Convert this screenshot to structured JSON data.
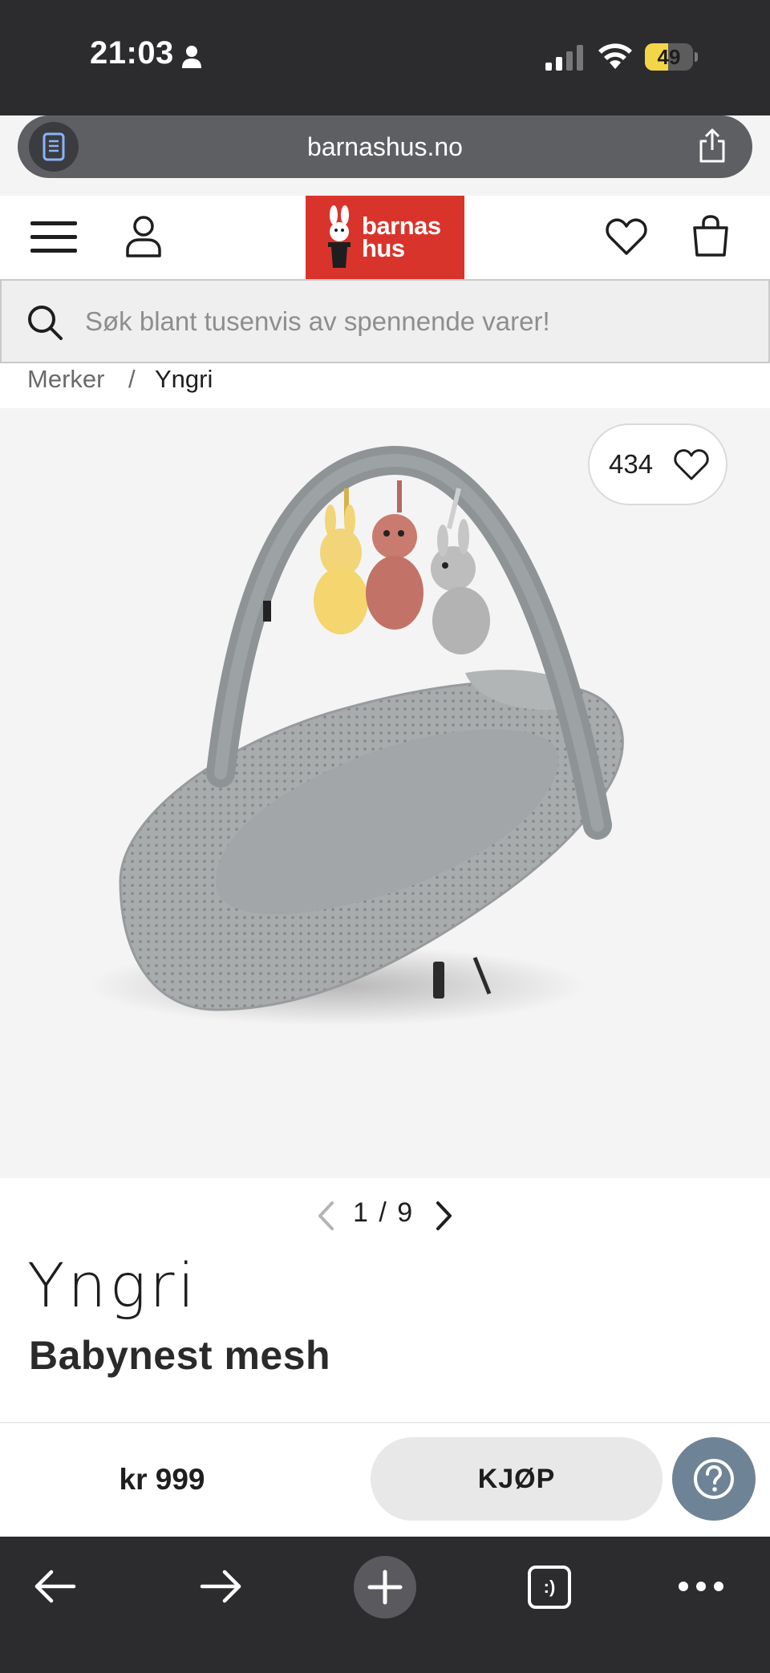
{
  "status_bar": {
    "time": "21:03",
    "battery_level": "49",
    "battery_fraction": 0.49,
    "icons": [
      "person-icon",
      "signal-icon",
      "wifi-icon",
      "battery-icon"
    ],
    "battery_color": "#f3d548"
  },
  "browser": {
    "url": "barnashus.no",
    "icons": [
      "reader-icon",
      "share-icon"
    ]
  },
  "header": {
    "logo_line1": "barnas",
    "logo_line2": "hus",
    "logo_color": "#d9342b",
    "icons": [
      "menu-icon",
      "user-icon",
      "heart-icon",
      "bag-icon"
    ]
  },
  "search": {
    "placeholder": "Søk blant tusenvis av spennende varer!",
    "value": ""
  },
  "breadcrumb": {
    "items": [
      "Merker",
      "Yngri"
    ],
    "separator": "/"
  },
  "gallery": {
    "favorites_count": "434",
    "pager": "1 / 9"
  },
  "product": {
    "brand": "Yngri",
    "title": "Babynest mesh",
    "price": "kr 999"
  },
  "buy_bar": {
    "buy_label": "KJØP",
    "help_color": "#6e8396"
  },
  "toolbar": {
    "tabs_label": ":)",
    "icons": [
      "back-arrow-icon",
      "forward-arrow-icon",
      "plus-icon",
      "tabs-icon",
      "more-icon"
    ]
  }
}
